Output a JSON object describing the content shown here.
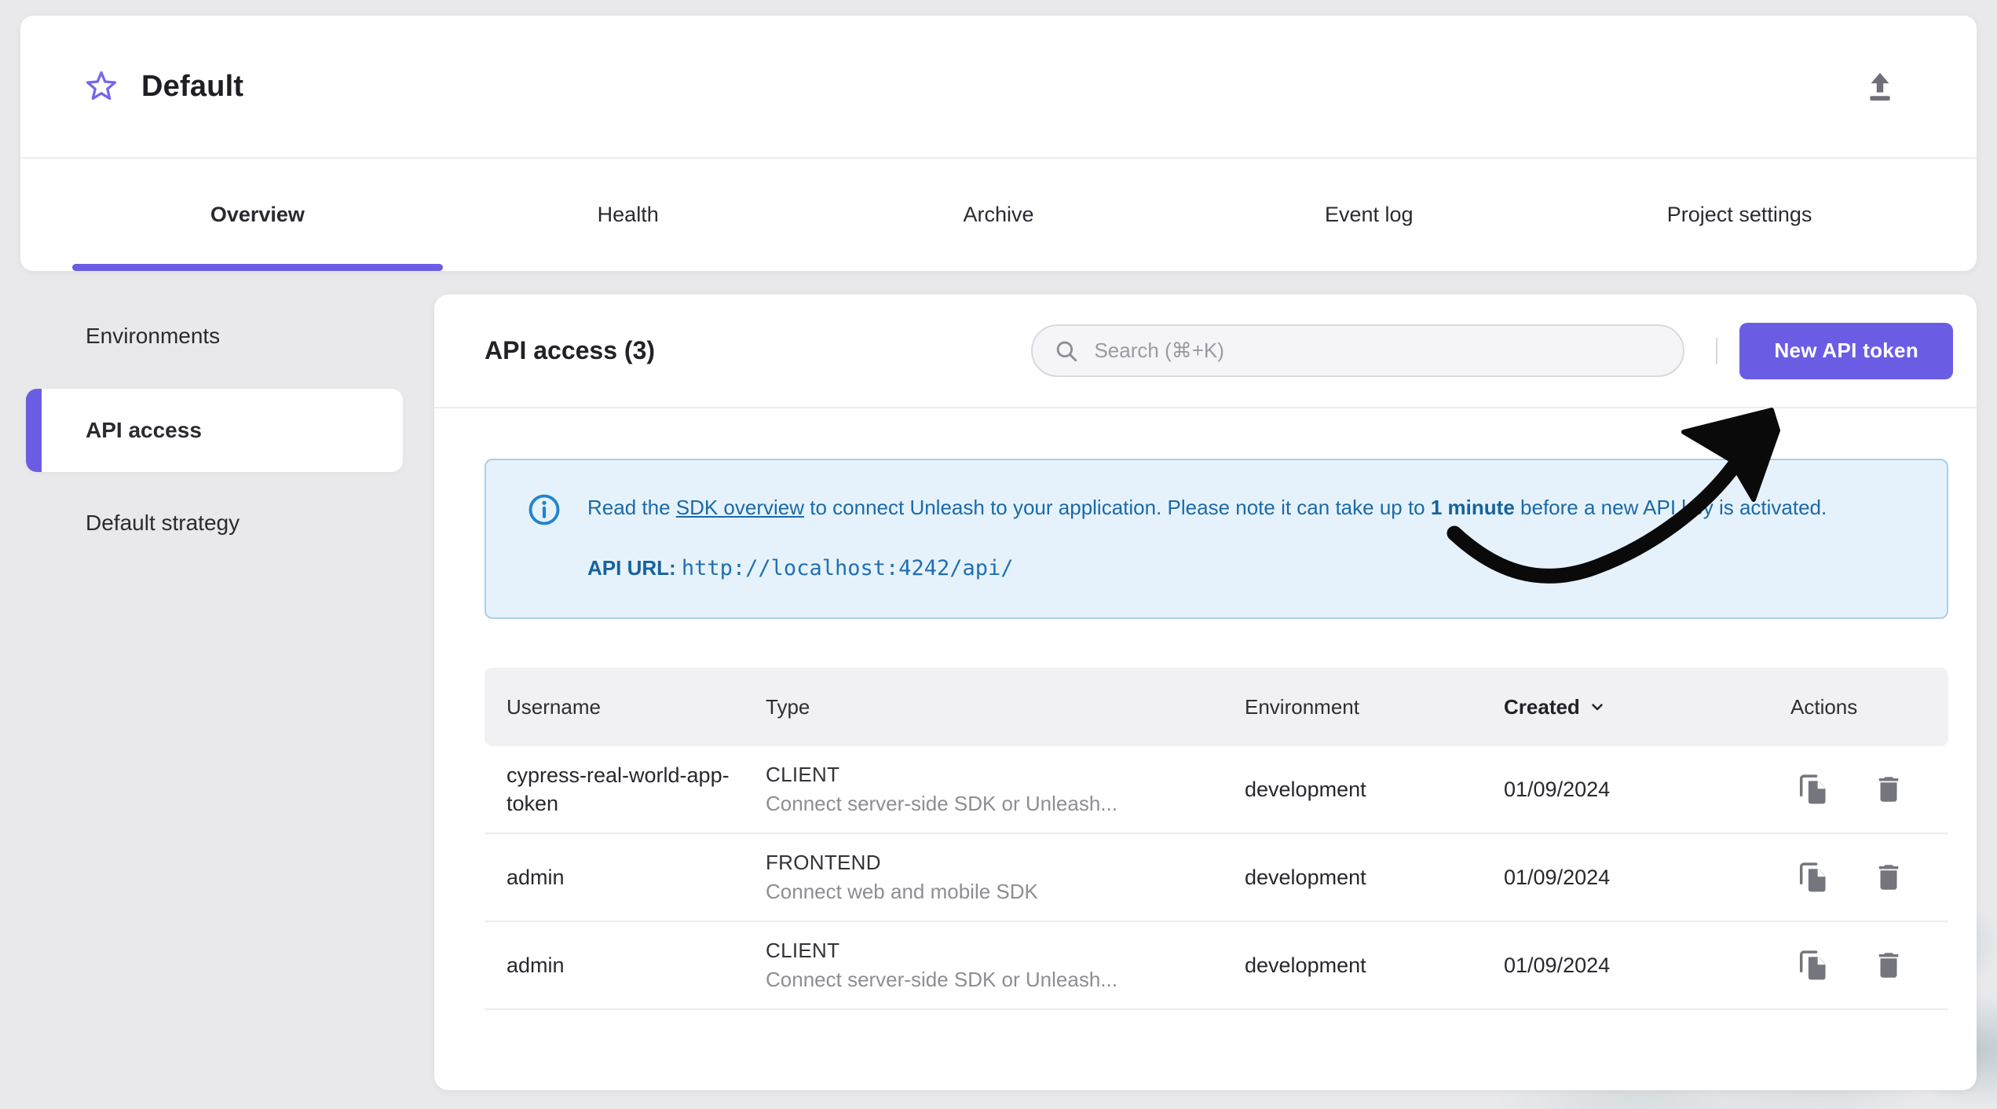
{
  "project_header": {
    "title": "Default",
    "icons": {
      "favorite": "star-outline-icon",
      "upload": "upload-icon"
    }
  },
  "tabs": [
    {
      "label": "Overview",
      "active": true
    },
    {
      "label": "Health",
      "active": false
    },
    {
      "label": "Archive",
      "active": false
    },
    {
      "label": "Event log",
      "active": false
    },
    {
      "label": "Project settings",
      "active": false
    }
  ],
  "sidebar": {
    "items": [
      {
        "label": "Environments",
        "active": false
      },
      {
        "label": "API access",
        "active": true
      },
      {
        "label": "Default strategy",
        "active": false
      }
    ]
  },
  "main": {
    "title": "API access (3)",
    "search": {
      "placeholder": "Search (⌘+K)",
      "icon": "search-icon"
    },
    "new_token_button": "New API token",
    "banner": {
      "icon": "info-icon",
      "text_before_link": "Read the ",
      "link_text": "SDK overview",
      "text_middle": " to connect Unleash to your application. Please note it can take up to ",
      "bold_text": "1 minute",
      "text_end": " before a new API key is activated.",
      "api_url_label": "API URL",
      "api_url_separator": ": ",
      "api_url": "http://localhost:4242/api/"
    },
    "table": {
      "columns": [
        "Username",
        "Type",
        "Environment",
        "Created",
        "Actions"
      ],
      "sorted_column": "Created",
      "sort_icon": "chevron-down-icon",
      "action_icons": [
        "copy-icon",
        "delete-icon"
      ],
      "rows": [
        {
          "username": "cypress-real-world-app-token",
          "type": "CLIENT",
          "type_description": "Connect server-side SDK or Unleash...",
          "environment": "development",
          "created": "01/09/2024"
        },
        {
          "username": "admin",
          "type": "FRONTEND",
          "type_description": "Connect web and mobile SDK",
          "environment": "development",
          "created": "01/09/2024"
        },
        {
          "username": "admin",
          "type": "CLIENT",
          "type_description": "Connect server-side SDK or Unleash...",
          "environment": "development",
          "created": "01/09/2024"
        }
      ]
    }
  },
  "colors": {
    "accent_purple": "#6b5de3",
    "banner_background": "#e6f2fb",
    "banner_text": "#1a6aa8",
    "page_background": "#e9e9eb"
  }
}
